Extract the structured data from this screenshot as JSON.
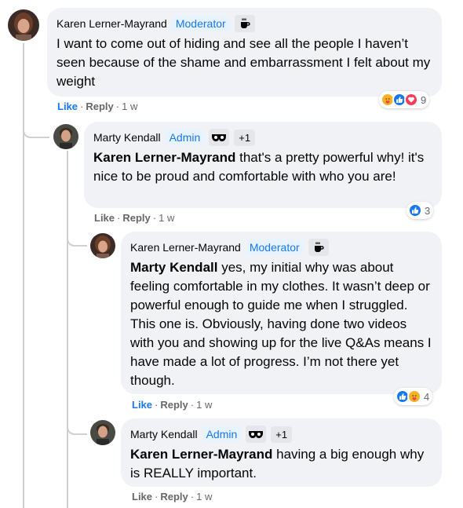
{
  "comments": [
    {
      "author": "Karen Lerner-Mayrand",
      "badge": "Moderator",
      "badge_icon": "coffee-icon",
      "text": "I want to come out of hiding and see all the people I haven’t seen because of the shame and embarrassment I felt about my weight",
      "actions": {
        "like": "Like",
        "reply": "Reply",
        "time": "1 w"
      },
      "reaction_count": "9",
      "reaction_icons": [
        "care-icon",
        "like-icon",
        "love-icon"
      ]
    },
    {
      "author": "Marty Kendall",
      "badge": "Admin",
      "badge_icon": "glasses-icon",
      "plus": "+1",
      "mention": "Karen Lerner-Mayrand",
      "text": " that's a pretty powerful why! it's nice to be proud and comfortable with who you are!",
      "actions": {
        "like": "Like",
        "reply": "Reply",
        "time": "1 w"
      },
      "reaction_count": "3",
      "reaction_icons": [
        "like-icon"
      ]
    },
    {
      "author": "Karen Lerner-Mayrand",
      "badge": "Moderator",
      "badge_icon": "coffee-icon",
      "mention": "Marty Kendall",
      "text": " yes, my initial why was about feeling comfortable in my clothes. It wasn’t deep or powerful enough to guide me when I struggled. This one is. Obviously, having done two videos with you and showing up for the live Q&As means I have made a lot of progress. I’m not there yet though.",
      "actions": {
        "like": "Like",
        "reply": "Reply",
        "time": "1 w"
      },
      "reaction_count": "4",
      "reaction_icons": [
        "like-icon",
        "care-icon"
      ]
    },
    {
      "author": "Marty Kendall",
      "badge": "Admin",
      "badge_icon": "glasses-icon",
      "plus": "+1",
      "mention": "Karen Lerner-Mayrand",
      "text": " having a big enough why is REALLY important.",
      "actions": {
        "like": "Like",
        "reply": "Reply",
        "time": "1 w"
      }
    }
  ],
  "colors": {
    "like_blue": "#1877f2",
    "bubble": "#f0f2f5",
    "meta_grey": "#65676b"
  }
}
